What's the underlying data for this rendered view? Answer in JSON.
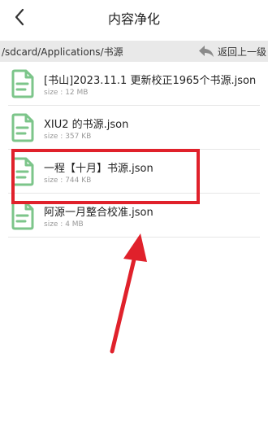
{
  "header": {
    "title": "内容净化"
  },
  "pathbar": {
    "path": "/sdcard/Applications/书源",
    "up_label": "返回上一级"
  },
  "files": [
    {
      "name": "[书山]2023.11.1 更新校正1965个书源.json",
      "size": "size : 12 MB"
    },
    {
      "name": "XIU2 的书源.json",
      "size": "size : 357 KB"
    },
    {
      "name": "一程【十月】书源.json",
      "size": "size : 744 KB"
    },
    {
      "name": "阿源一月整合校准.json",
      "size": "size : 4 MB"
    }
  ],
  "colors": {
    "icon_green": "#7cc58a",
    "annotation_red": "#e0212b"
  },
  "icons": {
    "back": "chevron-left-icon",
    "up": "back-arrow-icon",
    "file": "document-icon"
  }
}
